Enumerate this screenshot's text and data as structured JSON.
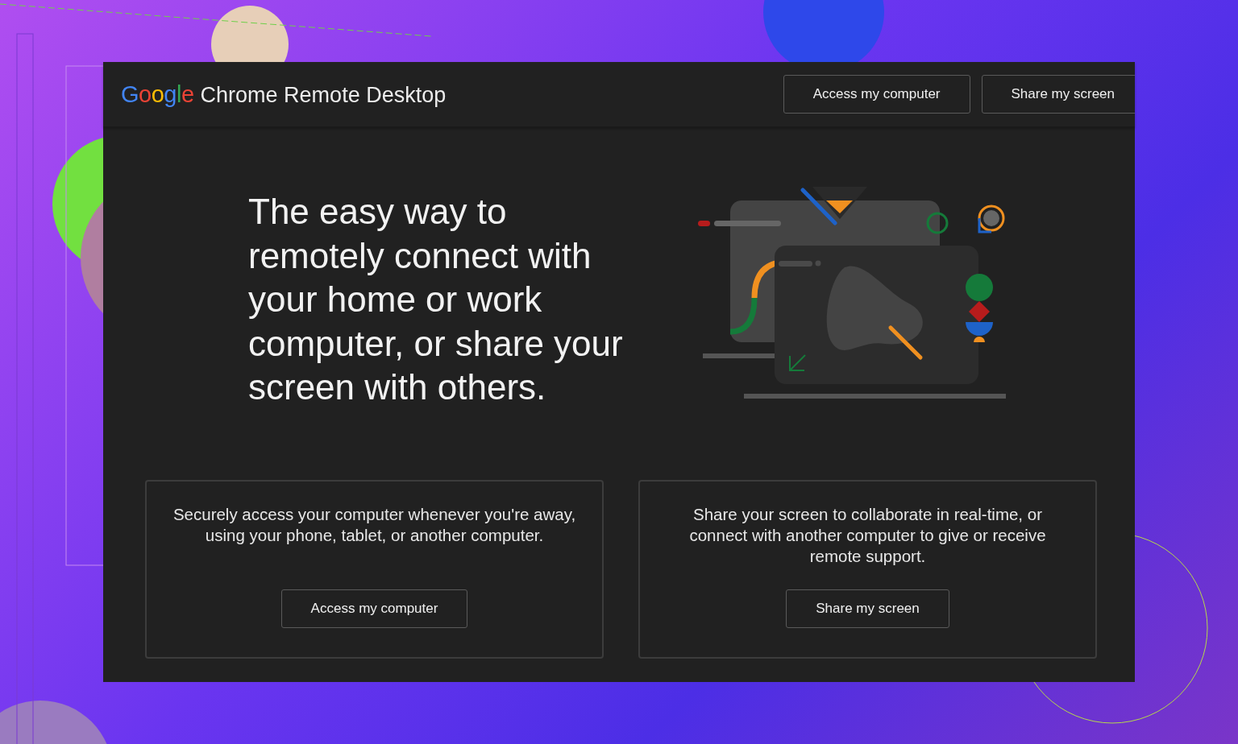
{
  "header": {
    "logo": "Google",
    "product": "Chrome Remote Desktop",
    "buttons": [
      "Access my computer",
      "Share my screen"
    ]
  },
  "hero": {
    "headline": "The easy way to remotely connect with your home or work computer, or share your screen with others."
  },
  "cards": [
    {
      "text": "Securely access your computer whenever you're away, using your phone, tablet, or another computer.",
      "button": "Access my computer"
    },
    {
      "text": "Share your screen to collaborate in real-time, or connect with another computer to give or receive remote support.",
      "button": "Share my screen"
    }
  ]
}
